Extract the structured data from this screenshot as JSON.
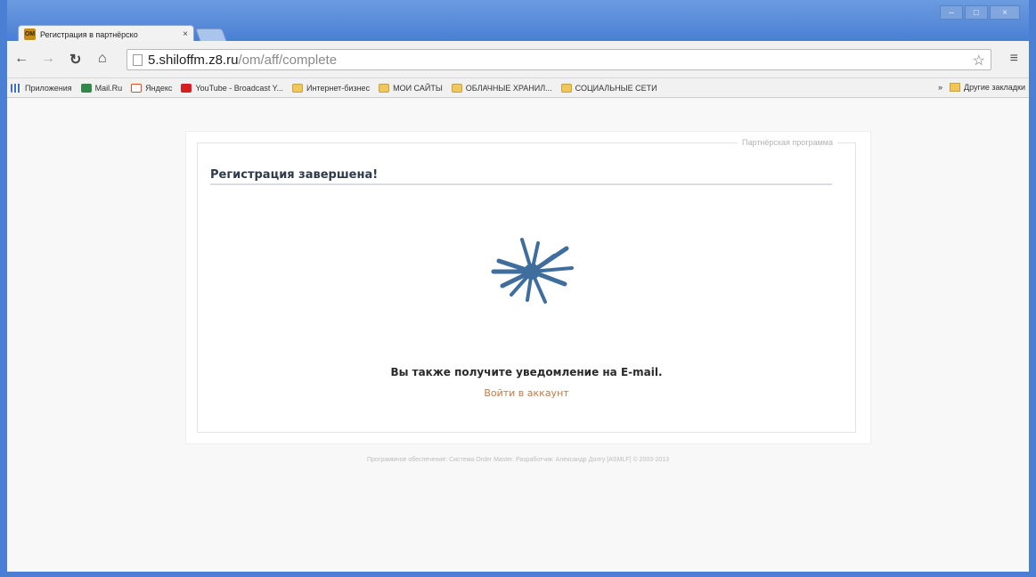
{
  "browser": {
    "tab_title": "Регистрация в партнёрско",
    "tab_close": "×",
    "window_controls": [
      "–",
      "□",
      "×"
    ],
    "url_host": "5.shiloffm.z8.ru",
    "url_path": "/om/aff/complete",
    "bookmarks": [
      {
        "label": "Приложения",
        "icon": "apps-grid-icon"
      },
      {
        "label": "Mail.Ru",
        "icon": "mailru-icon"
      },
      {
        "label": "Яндекс",
        "icon": "yandex-icon"
      },
      {
        "label": "YouTube - Broadcast Y...",
        "icon": "youtube-icon"
      },
      {
        "label": "Интернет-бизнес",
        "icon": "folder-icon"
      },
      {
        "label": "МОИ САЙТЫ",
        "icon": "folder-icon"
      },
      {
        "label": "ОБЛАЧНЫЕ ХРАНИЛ...",
        "icon": "folder-icon"
      },
      {
        "label": "СОЦИАЛЬНЫЕ СЕТИ",
        "icon": "folder-icon"
      }
    ],
    "bookmarks_overflow": "»",
    "other_bookmarks": "Другие закладки"
  },
  "page": {
    "legend": "Партнёрская программа",
    "title": "Регистрация завершена!",
    "notice": "Вы также получите уведомление на E-mail.",
    "login_link": "Войти в аккаунт",
    "footer": "Программное обеспечение: Система Order Master. Разработчик: Александр Долгу [ASMLF] © 2003-2013"
  },
  "colors": {
    "window_frame": "#4a7fd4",
    "logo": "#3f6e9e",
    "link": "#c27a45"
  }
}
